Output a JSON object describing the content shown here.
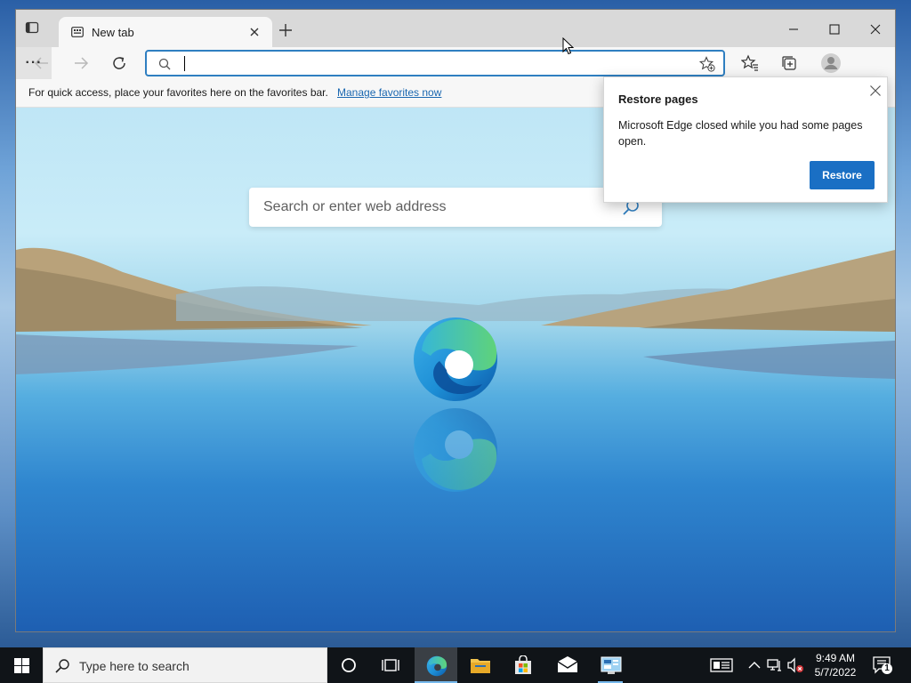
{
  "browser": {
    "tab": {
      "title": "New tab"
    },
    "address_bar": {
      "value": "",
      "placeholder": ""
    },
    "favorites_bar": {
      "message": "For quick access, place your favorites here on the favorites bar.",
      "link": "Manage favorites now"
    },
    "more_label": "···"
  },
  "page": {
    "search_placeholder": "Search or enter web address"
  },
  "restore_popup": {
    "title": "Restore pages",
    "body": "Microsoft Edge closed while you had some pages open.",
    "button": "Restore"
  },
  "taskbar": {
    "search_placeholder": "Type here to search",
    "time": "9:49 AM",
    "date": "5/7/2022",
    "notification_count": "1"
  },
  "colors": {
    "accent": "#1a6fc4",
    "address_focus": "#2f7fc1",
    "taskbar": "#101418",
    "link": "#1a67b0"
  }
}
